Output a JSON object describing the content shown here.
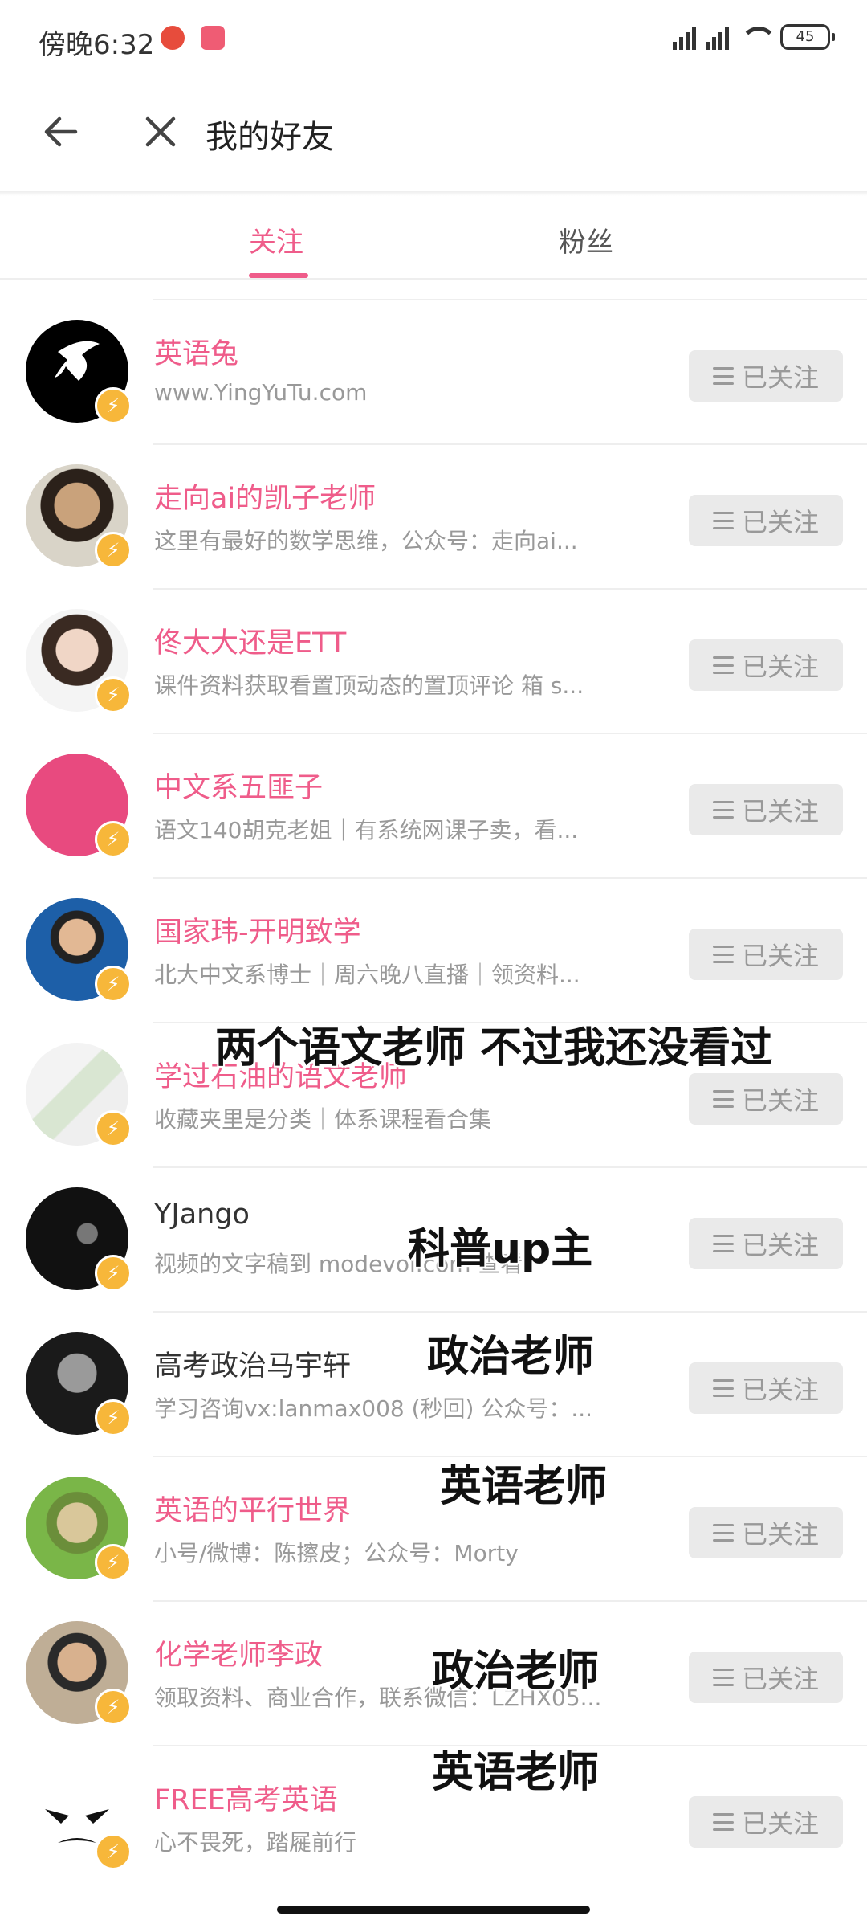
{
  "status_bar": {
    "time": "傍晚6:32",
    "battery": "45"
  },
  "header": {
    "title": "我的好友"
  },
  "tabs": [
    {
      "label": "关注",
      "active": true
    },
    {
      "label": "粉丝",
      "active": false
    }
  ],
  "follow_button_label": "已关注",
  "items": [
    {
      "name": "英语兔",
      "desc": "www.YingYuTu.com",
      "name_color": "#ef5c8a"
    },
    {
      "name": "走向ai的凯子老师",
      "desc": "这里有最好的数学思维，公众号：走向ai...",
      "name_color": "#ef5c8a"
    },
    {
      "name": "佟大大还是ETT",
      "desc": "课件资料获取看置顶动态的置顶评论 箱 s...",
      "name_color": "#ef5c8a"
    },
    {
      "name": "中文系五匪子",
      "desc": "语文140胡克老姐｜有系统网课子卖，看...",
      "name_color": "#ef5c8a"
    },
    {
      "name": "国家玮-开明致学",
      "desc": "北大中文系博士｜周六晚八直播｜领资料...",
      "name_color": "#ef5c8a"
    },
    {
      "name": "学过石油的语文老师",
      "desc": "收藏夹里是分类｜体系课程看合集",
      "name_color": "#ef5c8a"
    },
    {
      "name": "YJango",
      "desc": "视频的文字稿到 modevol.com 查看",
      "name_color": "#333333"
    },
    {
      "name": "高考政治马宇轩",
      "desc": "学习咨询vx:lanmax008 (秒回) 公众号：...",
      "name_color": "#333333"
    },
    {
      "name": "英语的平行世界",
      "desc": "小号/微博：陈擦皮；公众号：Morty",
      "name_color": "#ef5c8a"
    },
    {
      "name": "化学老师李政",
      "desc": "领取资料、商业合作，联系微信：LZHX05...",
      "name_color": "#ef5c8a"
    },
    {
      "name": "FREE高考英语",
      "desc": "心不畏死，踏屣前行",
      "name_color": "#ef5c8a"
    }
  ],
  "captions": [
    "两个语文老师 不过我还没看过",
    "科普up主",
    "政治老师",
    "英语老师",
    "政治老师",
    "英语老师"
  ],
  "colors": {
    "accent": "#ef5c8a",
    "badge": "#f7b73a",
    "button_bg": "#eaeaea"
  }
}
